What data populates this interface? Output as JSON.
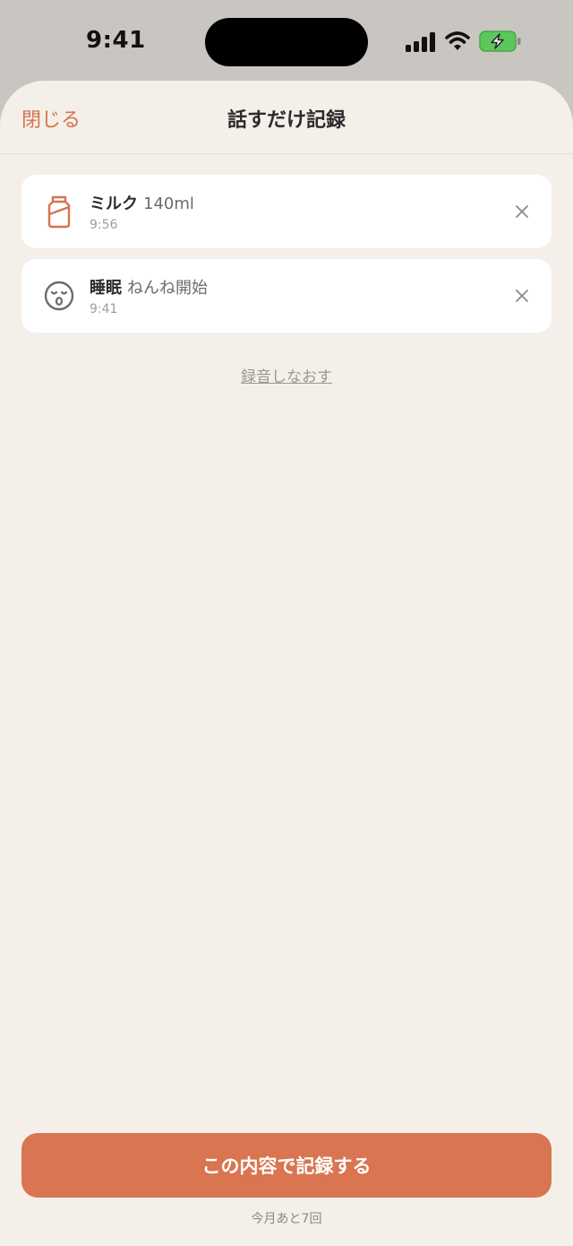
{
  "status_bar": {
    "time": "9:41",
    "icons": [
      "signal-icon",
      "wifi-icon",
      "battery-charging-icon"
    ]
  },
  "header": {
    "close_label": "閉じる",
    "title": "話すだけ記録"
  },
  "records": [
    {
      "icon": "milk-bottle-icon",
      "type": "ミルク",
      "detail": "140ml",
      "time": "9:56"
    },
    {
      "icon": "sleeping-face-icon",
      "type": "睡眠",
      "detail": "ねんね開始",
      "time": "9:41"
    }
  ],
  "rerecord_label": "録音しなおす",
  "footer": {
    "submit_label": "この内容で記録する",
    "remaining_note": "今月あと7回"
  },
  "colors": {
    "accent": "#d97551",
    "sheet_background": "#f4efe9",
    "card_background": "#ffffff",
    "battery_green": "#5cc75a"
  }
}
